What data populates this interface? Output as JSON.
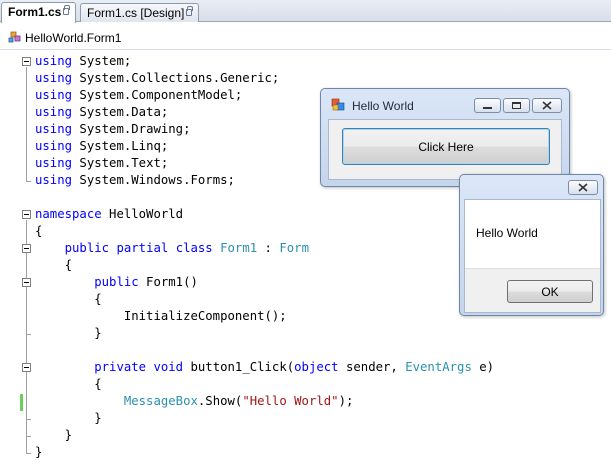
{
  "tabs": [
    {
      "label": "Form1.cs"
    },
    {
      "label": "Form1.cs [Design]"
    }
  ],
  "navigation": {
    "class_label": "HelloWorld.Form1"
  },
  "code": {
    "l0": [
      {
        "t": "using",
        "c": "kw"
      },
      {
        "t": " System;"
      }
    ],
    "l1": [
      {
        "t": "using",
        "c": "kw"
      },
      {
        "t": " System.Collections.Generic;"
      }
    ],
    "l2": [
      {
        "t": "using",
        "c": "kw"
      },
      {
        "t": " System.ComponentModel;"
      }
    ],
    "l3": [
      {
        "t": "using",
        "c": "kw"
      },
      {
        "t": " System.Data;"
      }
    ],
    "l4": [
      {
        "t": "using",
        "c": "kw"
      },
      {
        "t": " System.Drawing;"
      }
    ],
    "l5": [
      {
        "t": "using",
        "c": "kw"
      },
      {
        "t": " System.Linq;"
      }
    ],
    "l6": [
      {
        "t": "using",
        "c": "kw"
      },
      {
        "t": " System.Text;"
      }
    ],
    "l7": [
      {
        "t": "using",
        "c": "kw"
      },
      {
        "t": " System.Windows.Forms;"
      }
    ],
    "l9": [
      {
        "t": "namespace",
        "c": "kw"
      },
      {
        "t": " HelloWorld"
      }
    ],
    "l10": [
      {
        "t": "{"
      }
    ],
    "l11": [
      {
        "t": "    "
      },
      {
        "t": "public",
        "c": "kw"
      },
      {
        "t": " "
      },
      {
        "t": "partial",
        "c": "kw"
      },
      {
        "t": " "
      },
      {
        "t": "class",
        "c": "kw"
      },
      {
        "t": " "
      },
      {
        "t": "Form1",
        "c": "ty"
      },
      {
        "t": " : "
      },
      {
        "t": "Form",
        "c": "ty"
      }
    ],
    "l12": [
      {
        "t": "    {"
      }
    ],
    "l13": [
      {
        "t": "        "
      },
      {
        "t": "public",
        "c": "kw"
      },
      {
        "t": " Form1()"
      }
    ],
    "l14": [
      {
        "t": "        {"
      }
    ],
    "l15": [
      {
        "t": "            InitializeComponent();"
      }
    ],
    "l16": [
      {
        "t": "        }"
      }
    ],
    "l18": [
      {
        "t": "        "
      },
      {
        "t": "private",
        "c": "kw"
      },
      {
        "t": " "
      },
      {
        "t": "void",
        "c": "kw"
      },
      {
        "t": " button1_Click("
      },
      {
        "t": "object",
        "c": "kw"
      },
      {
        "t": " sender, "
      },
      {
        "t": "EventArgs",
        "c": "ty"
      },
      {
        "t": " e)"
      }
    ],
    "l19": [
      {
        "t": "        {"
      }
    ],
    "l20": [
      {
        "t": "            "
      },
      {
        "t": "MessageBox",
        "c": "ty"
      },
      {
        "t": ".Show("
      },
      {
        "t": "\"Hello World\"",
        "c": "str"
      },
      {
        "t": ");"
      }
    ],
    "l21": [
      {
        "t": "        }"
      }
    ],
    "l22": [
      {
        "t": "    }"
      }
    ],
    "l23": [
      {
        "t": "}"
      }
    ]
  },
  "form_window": {
    "title": "Hello World",
    "button_label": "Click Here"
  },
  "message_box": {
    "text": "Hello World",
    "ok_label": "OK"
  },
  "colors": {
    "keyword": "#0000ff",
    "type": "#2b91af",
    "string": "#a31515",
    "change_marker": "#6ccf5c"
  }
}
